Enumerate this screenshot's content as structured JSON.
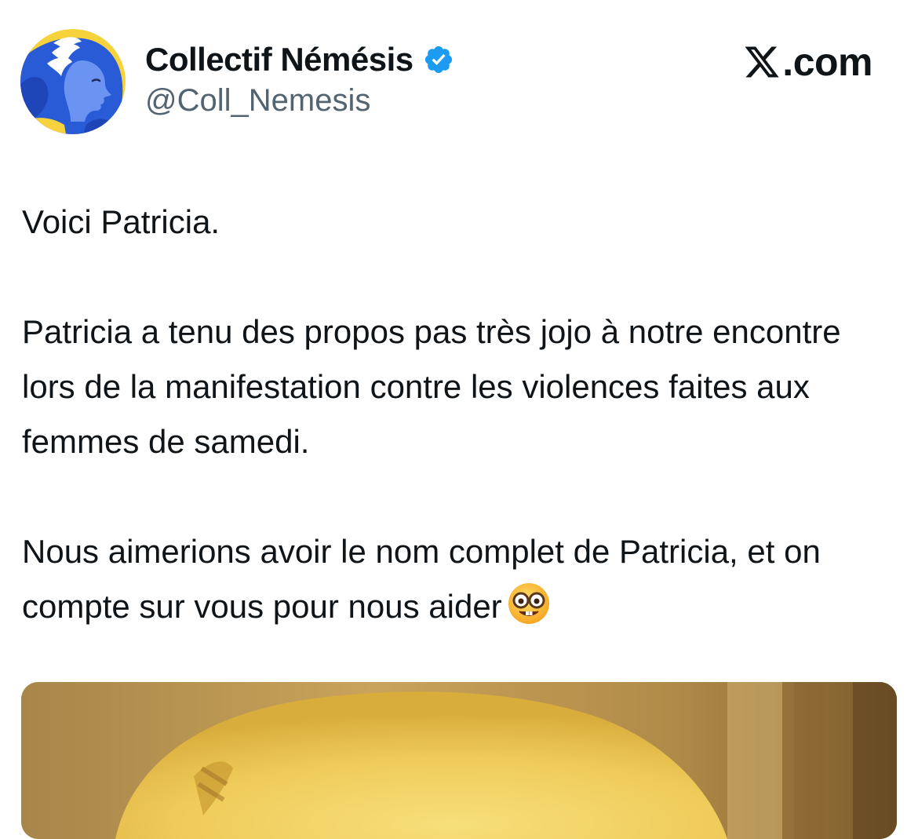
{
  "header": {
    "display_name": "Collectif Némésis",
    "handle": "@Coll_Nemesis",
    "verified": true,
    "site_label": ".com",
    "avatar_icon": "winged-woman-profile-avatar"
  },
  "tweet": {
    "paragraphs": [
      "Voici Patricia.",
      "Patricia a tenu des propos pas très jojo à notre encontre lors de la manifestation contre les violences faites aux femmes de samedi.",
      "Nous aimerions avoir le nom complet de Patricia, et on compte sur vous pour nous aider"
    ],
    "emoji_icon": "nerd-face-emoji"
  },
  "media": {
    "icon": "photo-attachment"
  },
  "colors": {
    "text_primary": "#0f1419",
    "text_secondary": "#536471",
    "verified_blue": "#1d9bf0",
    "avatar_yellow": "#f6d33c",
    "avatar_blue": "#2a5bd7"
  }
}
